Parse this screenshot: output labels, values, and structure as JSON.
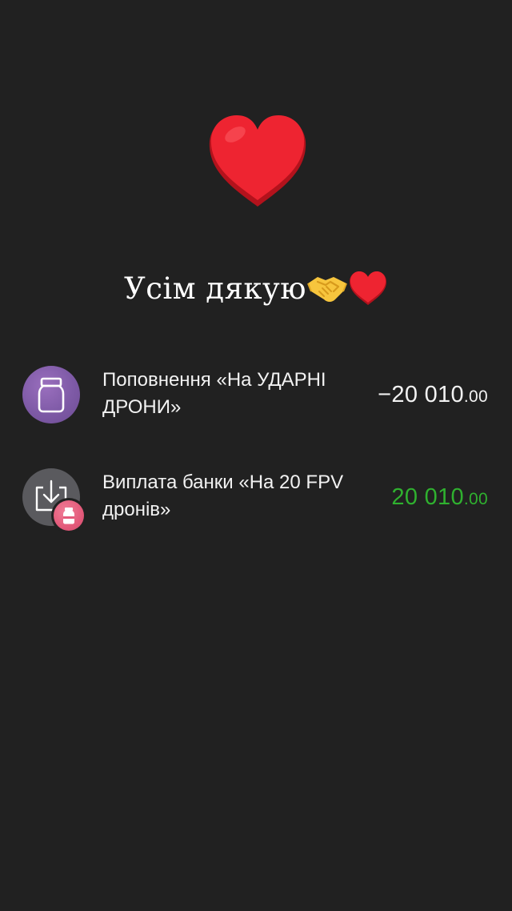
{
  "caption": {
    "text": "Усім дякую"
  },
  "transactions": [
    {
      "title": "Поповнення «На УДАРНІ ДРОНИ»",
      "amount_main": "−20 010",
      "amount_cents": ".00",
      "icon": "jar-icon",
      "color": "#f2f2f2"
    },
    {
      "title": "Виплата банки «На 20 FPV дронів»",
      "amount_main": "20 010",
      "amount_cents": ".00",
      "icon": "download-tray-icon",
      "badge_icon": "jar-icon",
      "color": "#2fb12f"
    }
  ],
  "colors": {
    "background": "#212121",
    "heart": "#e8202e",
    "positive": "#2fb12f",
    "jar_avatar": "#7e5aa6",
    "payout_avatar": "#5a5a5e",
    "badge": "#e35a7a"
  }
}
